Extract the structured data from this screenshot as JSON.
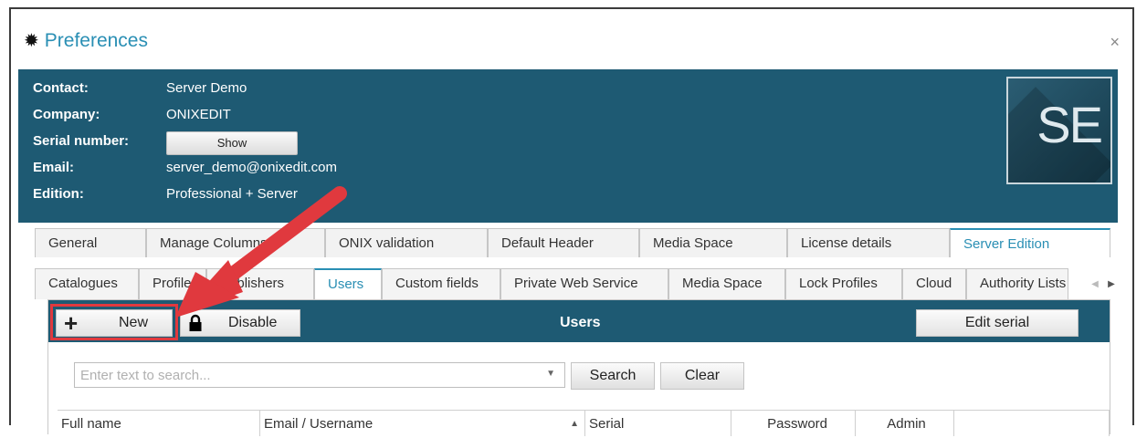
{
  "window": {
    "title": "Preferences",
    "icon": "gear-icon",
    "close_label": "×"
  },
  "contact_info": {
    "contact_label": "Contact:",
    "contact_value": "Server Demo",
    "company_label": "Company:",
    "company_value": "ONIXEDIT",
    "serial_label": "Serial number:",
    "serial_button": "Show",
    "email_label": "Email:",
    "email_value": "server_demo@onixedit.com",
    "edition_label": "Edition:",
    "edition_value": "Professional + Server",
    "logo_text": "SE"
  },
  "tabs_row1": [
    "General",
    "Manage Columns",
    "ONIX validation",
    "Default Header",
    "Media Space",
    "License details",
    "Server Edition"
  ],
  "tabs_row2": [
    "Catalogues",
    "Profiles",
    "Publishers",
    "Users",
    "Custom fields",
    "Private Web Service",
    "Media Space",
    "Lock Profiles",
    "Cloud",
    "Authority Lists"
  ],
  "toolbar": {
    "new_label": "New",
    "disable_label": "Disable",
    "title": "Users",
    "edit_serial_label": "Edit serial"
  },
  "search": {
    "placeholder": "Enter text to search...",
    "value": "",
    "search_label": "Search",
    "clear_label": "Clear"
  },
  "table": {
    "columns": [
      "Full name",
      "Email / Username",
      "Serial",
      "Password",
      "Admin"
    ],
    "sort_column": "Email / Username",
    "sort_direction": "ascending"
  },
  "colors": {
    "header_bg": "#1e5a73",
    "accent": "#2a8fb4",
    "highlight": "#e0393e"
  }
}
